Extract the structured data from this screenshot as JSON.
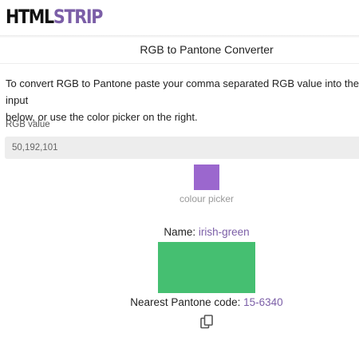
{
  "logo": {
    "part1": "HTML",
    "part2": "STRIP"
  },
  "page": {
    "title": "RGB to Pantone Converter"
  },
  "intro": {
    "text": "To convert RGB to Pantone paste your comma separated RGB value into the input\nbelow, or use the color picker on the right."
  },
  "rgb": {
    "label": "RGB value",
    "value": "50,192,101"
  },
  "picker": {
    "label": "colour picker",
    "color": "#9b67ce"
  },
  "result": {
    "name_label": "Name: ",
    "name_value": "irish-green",
    "code_label": "Nearest Pantone code: ",
    "code_value": "15-6340",
    "swatch_color": "#45bf71"
  },
  "icons": {
    "copy": "copy-icon"
  },
  "colors": {
    "brand": "#7b5ea7",
    "input_bg": "#ededed"
  }
}
